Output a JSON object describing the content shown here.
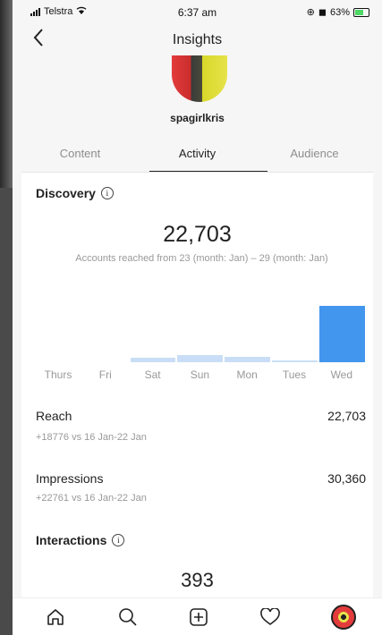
{
  "status_bar": {
    "carrier": "Telstra",
    "time": "6:37 am",
    "battery": "63%"
  },
  "header": {
    "title": "Insights",
    "back_icon": "chevron-left-icon"
  },
  "profile": {
    "username": "spagirlkris"
  },
  "tabs": [
    {
      "label": "Content",
      "active": false
    },
    {
      "label": "Activity",
      "active": true
    },
    {
      "label": "Audience",
      "active": false
    }
  ],
  "discovery": {
    "heading": "Discovery",
    "accounts_reached": "22,703",
    "note": "Accounts reached from  23 (month: Jan) – 29 (month: Jan)"
  },
  "chart_data": {
    "type": "bar",
    "categories": [
      "Thurs",
      "Fri",
      "Sat",
      "Sun",
      "Mon",
      "Tues",
      "Wed"
    ],
    "values": [
      0,
      0,
      800,
      1400,
      1000,
      150,
      10500
    ],
    "ylim": [
      0,
      11000
    ],
    "colors": {
      "highlight": "#4296ee",
      "faint": "#c9def6"
    }
  },
  "metrics": {
    "reach": {
      "label": "Reach",
      "value": "22,703",
      "sub": "+18776 vs 16 Jan-22 Jan"
    },
    "impressions": {
      "label": "Impressions",
      "value": "30,360",
      "sub": "+22761 vs 16 Jan-22 Jan"
    }
  },
  "interactions": {
    "heading": "Interactions",
    "value": "393"
  },
  "bottom_nav": [
    "home-icon",
    "search-icon",
    "add-post-icon",
    "heart-icon",
    "profile-avatar"
  ]
}
